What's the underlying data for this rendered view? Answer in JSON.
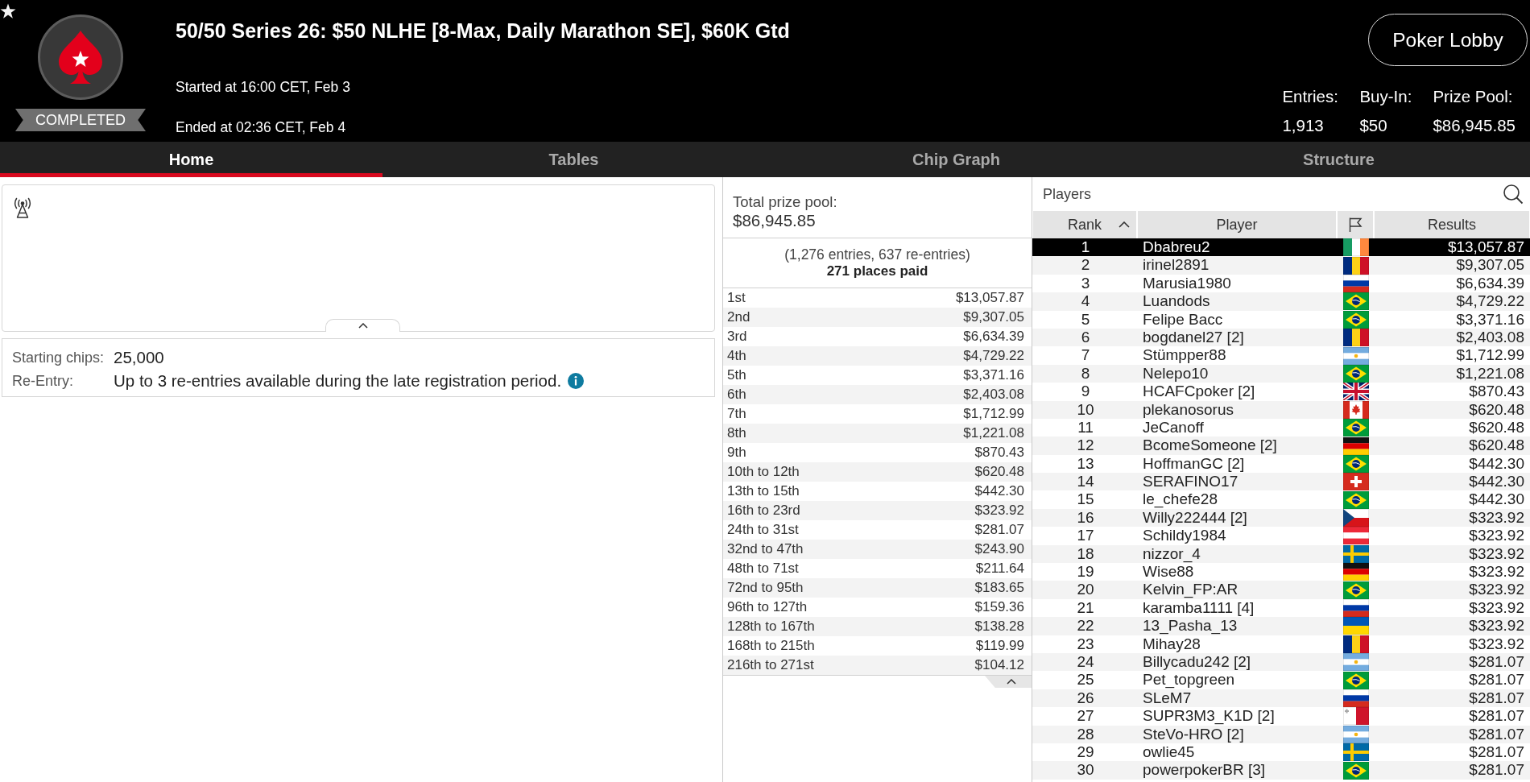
{
  "header": {
    "status": "COMPLETED",
    "title": "50/50 Series 26: $50 NLHE [8-Max, Daily Marathon SE], $60K Gtd",
    "started": "Started at 16:00 CET, Feb 3",
    "ended": "Ended at 02:36 CET, Feb 4",
    "lobby_button": "Poker Lobby",
    "stats": [
      {
        "label": "Entries:",
        "value": "1,913"
      },
      {
        "label": "Buy-In:",
        "value": "$50"
      },
      {
        "label": "Prize Pool:",
        "value": "$86,945.85"
      }
    ]
  },
  "tabs": [
    {
      "label": "Home",
      "selected": true
    },
    {
      "label": "Tables",
      "selected": false
    },
    {
      "label": "Chip Graph",
      "selected": false
    },
    {
      "label": "Structure",
      "selected": false
    }
  ],
  "tournament_info": {
    "rows": [
      {
        "label": "Starting chips:",
        "value": "25,000",
        "has_info": false
      },
      {
        "label": "Re-Entry:",
        "value": "Up to 3 re-entries available during the late registration period.",
        "has_info": true
      }
    ]
  },
  "prize_pool": {
    "label": "Total prize pool:",
    "amount": "$86,945.85",
    "entries_note": "(1,276 entries, 637 re-entries)",
    "places_paid": "271 places paid",
    "payouts": [
      {
        "place": "1st",
        "amount": "$13,057.87"
      },
      {
        "place": "2nd",
        "amount": "$9,307.05"
      },
      {
        "place": "3rd",
        "amount": "$6,634.39"
      },
      {
        "place": "4th",
        "amount": "$4,729.22"
      },
      {
        "place": "5th",
        "amount": "$3,371.16"
      },
      {
        "place": "6th",
        "amount": "$2,403.08"
      },
      {
        "place": "7th",
        "amount": "$1,712.99"
      },
      {
        "place": "8th",
        "amount": "$1,221.08"
      },
      {
        "place": "9th",
        "amount": "$870.43"
      },
      {
        "place": "10th to 12th",
        "amount": "$620.48"
      },
      {
        "place": "13th to 15th",
        "amount": "$442.30"
      },
      {
        "place": "16th to 23rd",
        "amount": "$323.92"
      },
      {
        "place": "24th to 31st",
        "amount": "$281.07"
      },
      {
        "place": "32nd to 47th",
        "amount": "$243.90"
      },
      {
        "place": "48th to 71st",
        "amount": "$211.64"
      },
      {
        "place": "72nd to 95th",
        "amount": "$183.65"
      },
      {
        "place": "96th to 127th",
        "amount": "$159.36"
      },
      {
        "place": "128th to 167th",
        "amount": "$138.28"
      },
      {
        "place": "168th to 215th",
        "amount": "$119.99"
      },
      {
        "place": "216th to 271st",
        "amount": "$104.12"
      }
    ]
  },
  "players": {
    "title": "Players",
    "columns": [
      {
        "kind": "text",
        "label": "Rank",
        "sorted": true
      },
      {
        "kind": "text",
        "label": "Player",
        "sorted": false
      },
      {
        "kind": "flag",
        "sorted": false
      },
      {
        "kind": "text",
        "label": "Results",
        "sorted": false
      }
    ],
    "rows": [
      {
        "rank": "1",
        "player": "Dbabreu2",
        "flag": {
          "kind": "ireland"
        },
        "result": "$13,057.87",
        "selected": true
      },
      {
        "rank": "2",
        "player": "irinel2891",
        "flag": {
          "kind": "romania"
        },
        "result": "$9,307.05",
        "selected": false
      },
      {
        "rank": "3",
        "player": "Marusia1980",
        "flag": {
          "kind": "russia"
        },
        "result": "$6,634.39",
        "selected": false
      },
      {
        "rank": "4",
        "player": "Luandods",
        "flag": {
          "kind": "brazil"
        },
        "result": "$4,729.22",
        "selected": false
      },
      {
        "rank": "5",
        "player": "Felipe Bacc",
        "flag": {
          "kind": "brazil"
        },
        "result": "$3,371.16",
        "selected": false
      },
      {
        "rank": "6",
        "player": "bogdanel27 [2]",
        "flag": {
          "kind": "romania"
        },
        "result": "$2,403.08",
        "selected": false
      },
      {
        "rank": "7",
        "player": "Stümpper88",
        "flag": {
          "kind": "argentina"
        },
        "result": "$1,712.99",
        "selected": false
      },
      {
        "rank": "8",
        "player": "Nelepo10",
        "flag": {
          "kind": "brazil"
        },
        "result": "$1,221.08",
        "selected": false
      },
      {
        "rank": "9",
        "player": "HCAFCpoker [2]",
        "flag": {
          "kind": "uk"
        },
        "result": "$870.43",
        "selected": false
      },
      {
        "rank": "10",
        "player": "plekanosorus",
        "flag": {
          "kind": "canada"
        },
        "result": "$620.48",
        "selected": false
      },
      {
        "rank": "11",
        "player": "JeCanoff",
        "flag": {
          "kind": "brazil"
        },
        "result": "$620.48",
        "selected": false
      },
      {
        "rank": "12",
        "player": "BcomeSomeone [2]",
        "flag": {
          "kind": "germany"
        },
        "result": "$620.48",
        "selected": false
      },
      {
        "rank": "13",
        "player": "HoffmanGC [2]",
        "flag": {
          "kind": "brazil"
        },
        "result": "$442.30",
        "selected": false
      },
      {
        "rank": "14",
        "player": "SERAFINO17",
        "flag": {
          "kind": "switzerland"
        },
        "result": "$442.30",
        "selected": false
      },
      {
        "rank": "15",
        "player": "le_chefe28",
        "flag": {
          "kind": "brazil"
        },
        "result": "$442.30",
        "selected": false
      },
      {
        "rank": "16",
        "player": "Willy222444 [2]",
        "flag": {
          "kind": "czechia"
        },
        "result": "$323.92",
        "selected": false
      },
      {
        "rank": "17",
        "player": "Schildy1984",
        "flag": {
          "kind": "austria"
        },
        "result": "$323.92",
        "selected": false
      },
      {
        "rank": "18",
        "player": "nizzor_4",
        "flag": {
          "kind": "sweden"
        },
        "result": "$323.92",
        "selected": false
      },
      {
        "rank": "19",
        "player": "Wise88",
        "flag": {
          "kind": "germany"
        },
        "result": "$323.92",
        "selected": false
      },
      {
        "rank": "20",
        "player": "Kelvin_FP:AR",
        "flag": {
          "kind": "brazil"
        },
        "result": "$323.92",
        "selected": false
      },
      {
        "rank": "21",
        "player": "karamba1111 [4]",
        "flag": {
          "kind": "russia"
        },
        "result": "$323.92",
        "selected": false
      },
      {
        "rank": "22",
        "player": "13_Pasha_13",
        "flag": {
          "kind": "ukraine"
        },
        "result": "$323.92",
        "selected": false
      },
      {
        "rank": "23",
        "player": "Mihay28",
        "flag": {
          "kind": "romania"
        },
        "result": "$323.92",
        "selected": false
      },
      {
        "rank": "24",
        "player": "Billycadu242 [2]",
        "flag": {
          "kind": "argentina"
        },
        "result": "$281.07",
        "selected": false
      },
      {
        "rank": "25",
        "player": "Pet_topgreen",
        "flag": {
          "kind": "brazil"
        },
        "result": "$281.07",
        "selected": false
      },
      {
        "rank": "26",
        "player": "SLeM7",
        "flag": {
          "kind": "russia"
        },
        "result": "$281.07",
        "selected": false
      },
      {
        "rank": "27",
        "player": "SUPR3M3_K1D [2]",
        "flag": {
          "kind": "malta"
        },
        "result": "$281.07",
        "selected": false
      },
      {
        "rank": "28",
        "player": "SteVo-HRO [2]",
        "flag": {
          "kind": "argentina"
        },
        "result": "$281.07",
        "selected": false
      },
      {
        "rank": "29",
        "player": "owlie45",
        "flag": {
          "kind": "sweden"
        },
        "result": "$281.07",
        "selected": false
      },
      {
        "rank": "30",
        "player": "powerpokerBR [3]",
        "flag": {
          "kind": "brazil"
        },
        "result": "$281.07",
        "selected": false
      }
    ]
  }
}
